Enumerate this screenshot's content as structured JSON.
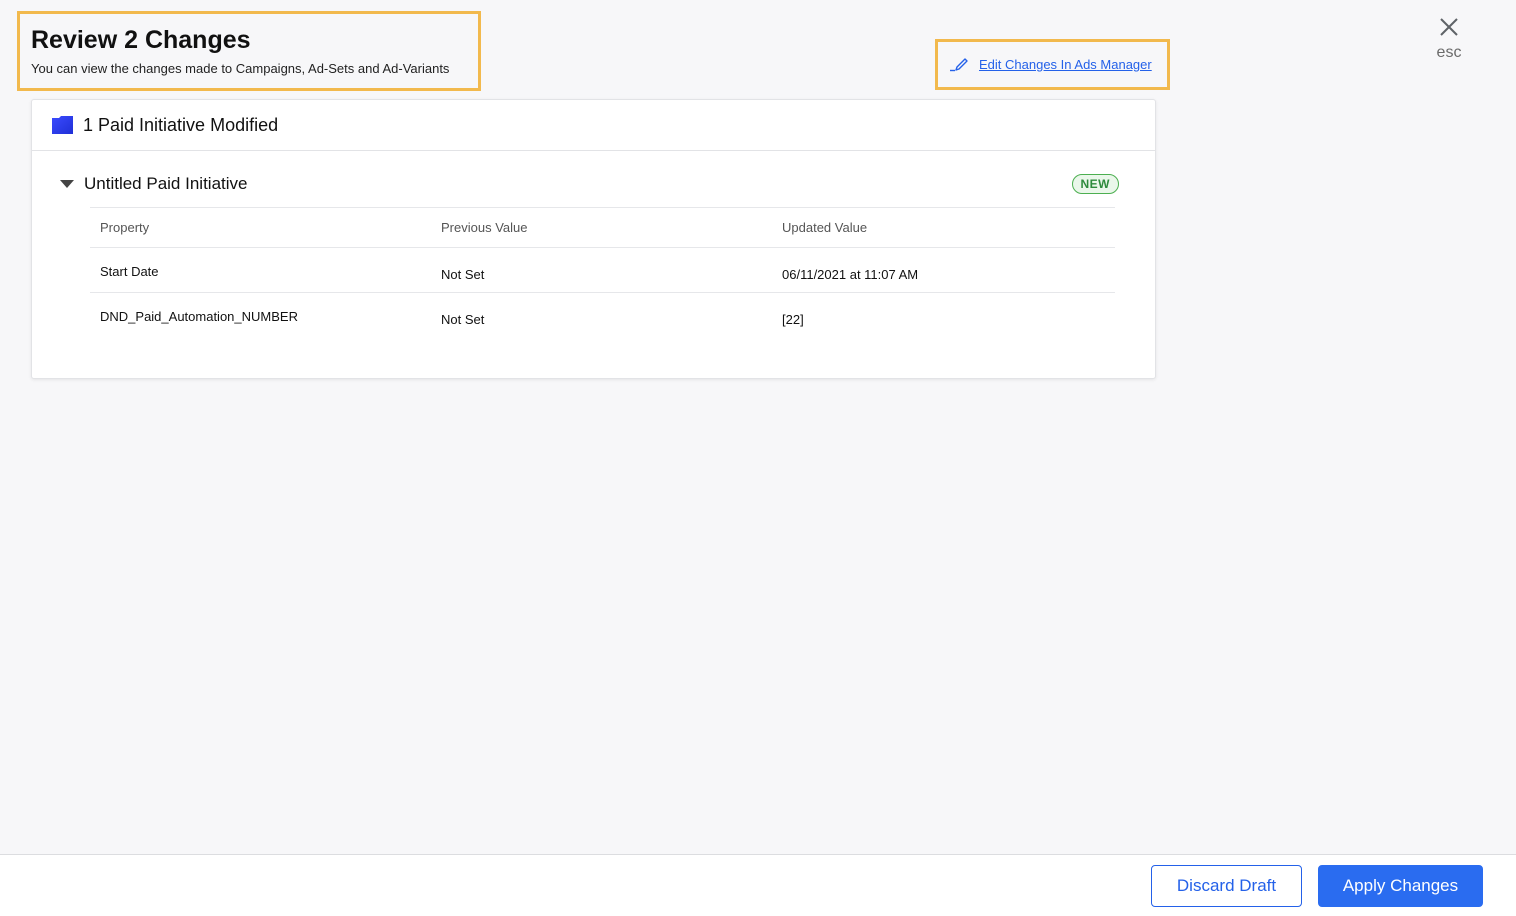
{
  "header": {
    "title": "Review 2 Changes",
    "subtitle": "You can view the changes made to Campaigns, Ad-Sets and Ad-Variants",
    "edit_link_label": "Edit Changes In Ads Manager",
    "close_label": "esc"
  },
  "card": {
    "title": "1 Paid Initiative Modified",
    "initiative": {
      "name": "Untitled Paid Initiative",
      "badge": "NEW"
    },
    "table": {
      "columns": [
        "Property",
        "Previous Value",
        "Updated Value"
      ],
      "rows": [
        [
          "Start Date",
          "Not Set",
          "06/11/2021 at 11:07 AM"
        ],
        [
          "DND_Paid_Automation_NUMBER",
          "Not Set",
          "[22]"
        ]
      ]
    }
  },
  "footer": {
    "discard_label": "Discard Draft",
    "apply_label": "Apply Changes"
  },
  "colors": {
    "accent": "#2a6cf0",
    "link": "#2461e9",
    "highlight_border": "#f2b94d",
    "badge_green": "#4caf50",
    "folder_blue": "#2b3cf0"
  },
  "icons": {
    "edit": "pencil-icon",
    "close": "close-icon",
    "folder": "folder-icon",
    "caret": "caret-down-icon"
  }
}
